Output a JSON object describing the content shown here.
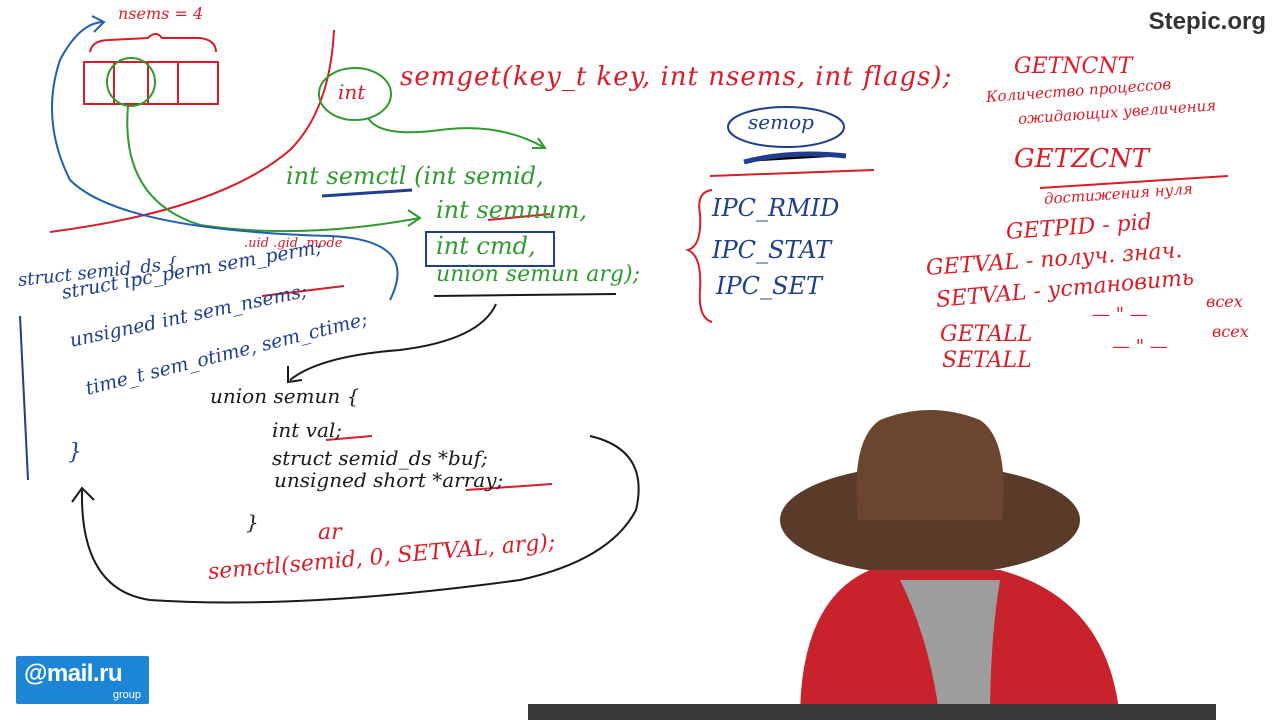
{
  "watermark": "Stepic.org",
  "logo": {
    "main": "@mail.ru",
    "sub": "group"
  },
  "semget": {
    "nsems_note": "nsems = 4",
    "int_label": "int",
    "call": "semget(key_t key, int nsems, int flags);"
  },
  "semctl": {
    "line1": "int semctl (int semid,",
    "line2": "int semnum,",
    "line3": "int cmd,",
    "line4": "union semun arg);"
  },
  "semid_ds": {
    "field_hints": ".uid .gid .mode",
    "line1": "struct semid_ds {",
    "line2": "struct ipc_perm sem_perm;",
    "line3": "unsigned int sem_nsems;",
    "line4": "time_t sem_otime, sem_ctime;",
    "close": "}"
  },
  "semun": {
    "line1": "union semun {",
    "line2": "int val;",
    "line3": "struct semid_ds *buf;",
    "line4": "unsigned short *array;",
    "close": "}",
    "partial": "ar"
  },
  "semctl_example": "semctl(semid, 0, SETVAL, arg);",
  "semop_label": "semop",
  "ipc_commands": [
    "IPC_RMID",
    "IPC_STAT",
    "IPC_SET"
  ],
  "red_notes": {
    "getncnt": "GETNCNT",
    "getncnt_desc_1": "Количество процессов",
    "getncnt_desc_2": "ожидающих увеличения",
    "getzcnt": "GETZCNT",
    "getzcnt_desc": "достижения нуля",
    "getpid": "GETPID - pid",
    "getval": "GETVAL - получ. знач.",
    "setval": "SETVAL - установить",
    "getall": "GETALL",
    "setall": "SETALL",
    "all_1": "всех",
    "all_2": "всех",
    "ditto": "— \" —"
  }
}
